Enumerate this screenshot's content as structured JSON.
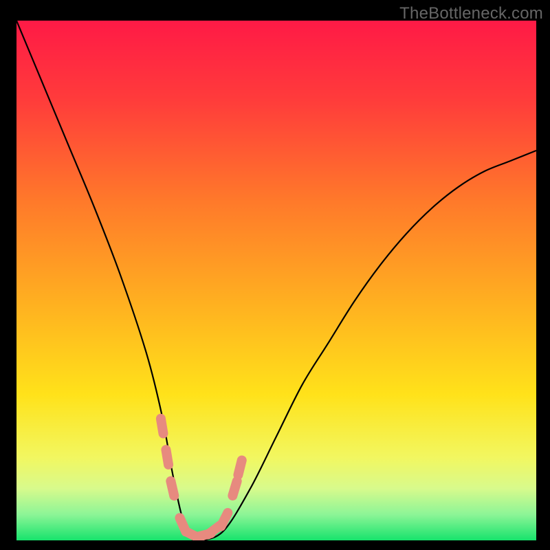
{
  "watermark": "TheBottleneck.com",
  "chart_data": {
    "type": "line",
    "title": "",
    "xlabel": "",
    "ylabel": "",
    "xlim": [
      0,
      100
    ],
    "ylim": [
      0,
      100
    ],
    "series": [
      {
        "name": "curve",
        "x": [
          0,
          5,
          10,
          15,
          20,
          25,
          28,
          30,
          32,
          34,
          36,
          40,
          45,
          50,
          55,
          60,
          65,
          70,
          75,
          80,
          85,
          90,
          95,
          100
        ],
        "y": [
          100,
          88,
          76,
          64,
          51,
          36,
          24,
          13,
          4,
          0,
          0,
          2,
          10,
          20,
          30,
          38,
          46,
          53,
          59,
          64,
          68,
          71,
          73,
          75
        ]
      }
    ],
    "optimal_range": {
      "x_start": 30,
      "x_end": 40
    },
    "markers": [
      {
        "x": 28,
        "y": 22
      },
      {
        "x": 29,
        "y": 16
      },
      {
        "x": 30,
        "y": 10
      },
      {
        "x": 32,
        "y": 3
      },
      {
        "x": 34,
        "y": 1
      },
      {
        "x": 36,
        "y": 1
      },
      {
        "x": 38,
        "y": 2
      },
      {
        "x": 40,
        "y": 4
      },
      {
        "x": 42,
        "y": 10
      },
      {
        "x": 43,
        "y": 14
      }
    ],
    "gradient_stops": [
      {
        "offset": 0,
        "color": "#ff1a46"
      },
      {
        "offset": 0.15,
        "color": "#ff3b3b"
      },
      {
        "offset": 0.35,
        "color": "#ff7a2a"
      },
      {
        "offset": 0.55,
        "color": "#ffb220"
      },
      {
        "offset": 0.72,
        "color": "#ffe21a"
      },
      {
        "offset": 0.84,
        "color": "#f2f760"
      },
      {
        "offset": 0.9,
        "color": "#d8fa8c"
      },
      {
        "offset": 0.95,
        "color": "#8df597"
      },
      {
        "offset": 1.0,
        "color": "#17e36c"
      }
    ]
  }
}
